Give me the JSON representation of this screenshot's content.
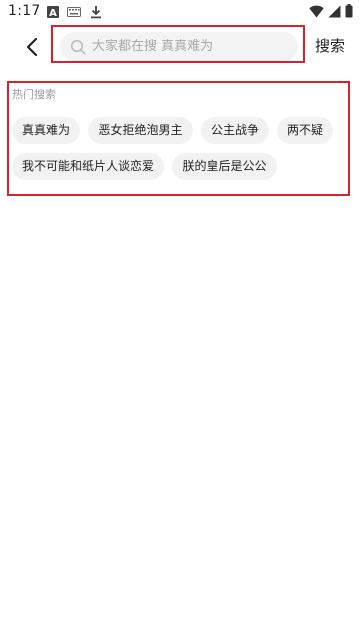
{
  "status_bar": {
    "time": "1:17",
    "icons": [
      "a-notification-icon",
      "keyboard-icon",
      "download-icon",
      "wifi-icon",
      "signal-icon",
      "battery-icon"
    ]
  },
  "header": {
    "search_placeholder": "大家都在搜 真真难为",
    "search_button_label": "搜索",
    "icons": [
      "back-arrow-icon",
      "search-icon"
    ]
  },
  "hot_search": {
    "title": "热门搜索",
    "tags": [
      "真真难为",
      "恶女拒绝泡男主",
      "公主战争",
      "两不疑",
      "我不可能和纸片人谈恋爱",
      "朕的皇后是公公"
    ]
  },
  "colors": {
    "highlight": "#d6222c",
    "tag_background": "#f2f2f2",
    "search_background": "#f3f3f3",
    "placeholder": "#a8a8a8"
  }
}
